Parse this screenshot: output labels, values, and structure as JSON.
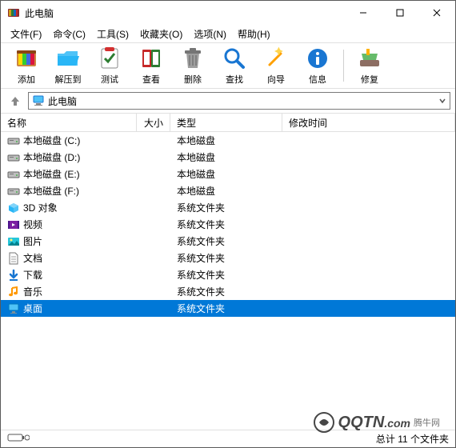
{
  "window": {
    "title": "此电脑"
  },
  "menu": {
    "file": "文件(F)",
    "command": "命令(C)",
    "tools": "工具(S)",
    "favorites": "收藏夹(O)",
    "options": "选项(N)",
    "help": "帮助(H)"
  },
  "toolbar": {
    "add": "添加",
    "extract": "解压到",
    "test": "测试",
    "view": "查看",
    "delete": "删除",
    "find": "查找",
    "wizard": "向导",
    "info": "信息",
    "repair": "修复"
  },
  "address": {
    "path": "此电脑"
  },
  "headers": {
    "name": "名称",
    "size": "大小",
    "type": "类型",
    "date": "修改时间"
  },
  "items": [
    {
      "name": "本地磁盘 (C:)",
      "type": "本地磁盘",
      "icon": "drive"
    },
    {
      "name": "本地磁盘 (D:)",
      "type": "本地磁盘",
      "icon": "drive"
    },
    {
      "name": "本地磁盘 (E:)",
      "type": "本地磁盘",
      "icon": "drive"
    },
    {
      "name": "本地磁盘 (F:)",
      "type": "本地磁盘",
      "icon": "drive"
    },
    {
      "name": "3D 对象",
      "type": "系统文件夹",
      "icon": "3d"
    },
    {
      "name": "视频",
      "type": "系统文件夹",
      "icon": "video"
    },
    {
      "name": "图片",
      "type": "系统文件夹",
      "icon": "picture"
    },
    {
      "name": "文档",
      "type": "系统文件夹",
      "icon": "document"
    },
    {
      "name": "下载",
      "type": "系统文件夹",
      "icon": "download"
    },
    {
      "name": "音乐",
      "type": "系统文件夹",
      "icon": "music"
    },
    {
      "name": "桌面",
      "type": "系统文件夹",
      "icon": "desktop",
      "selected": true
    }
  ],
  "status": {
    "summary": "总计 11 个文件夹"
  },
  "watermark": {
    "main": "QQTN",
    "domain": ".com",
    "sub": "腾牛网"
  }
}
